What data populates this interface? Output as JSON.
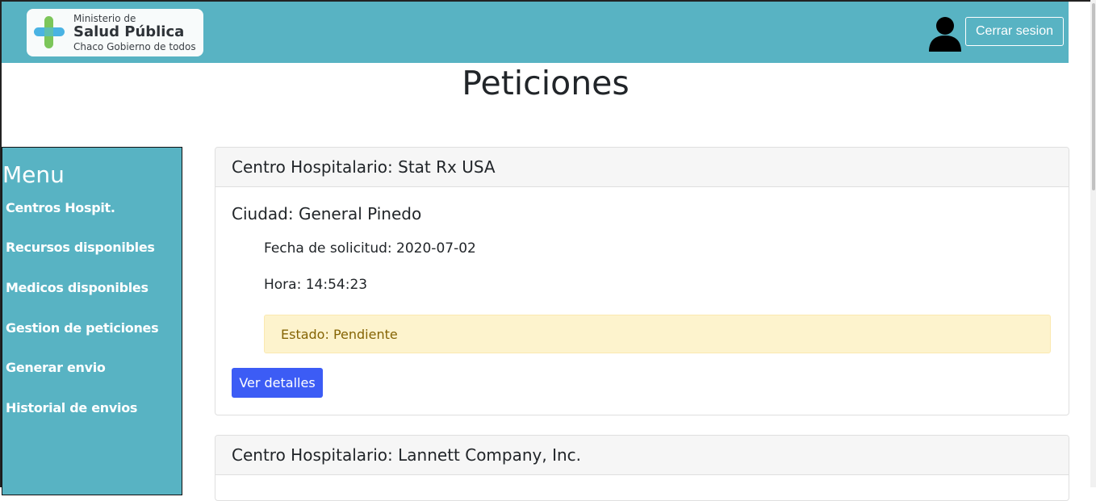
{
  "header": {
    "logo": {
      "line1": "Ministerio de",
      "line2": "Salud Pública",
      "line3": "Chaco Gobierno de todos"
    },
    "logout_label": "Cerrar sesion"
  },
  "page_title": "Peticiones",
  "sidebar": {
    "title": "Menu",
    "items": [
      {
        "label": "Centros Hospit."
      },
      {
        "label": "Recursos disponibles"
      },
      {
        "label": "Medicos disponibles"
      },
      {
        "label": "Gestion de peticiones"
      },
      {
        "label": "Generar envio"
      },
      {
        "label": "Historial de envios"
      }
    ]
  },
  "peticiones": [
    {
      "header": "Centro Hospitalario: Stat Rx USA",
      "city": "Ciudad: General Pinedo",
      "date": "Fecha de solicitud: 2020-07-02",
      "time": "Hora: 14:54:23",
      "status": "Estado: Pendiente",
      "button_label": "Ver detalles"
    },
    {
      "header": "Centro Hospitalario: Lannett Company, Inc."
    }
  ],
  "colors": {
    "navbar": "#58b3c3",
    "primary_button": "#3c5cf5",
    "status_bg": "#fdf3cd",
    "status_text": "#856404"
  }
}
